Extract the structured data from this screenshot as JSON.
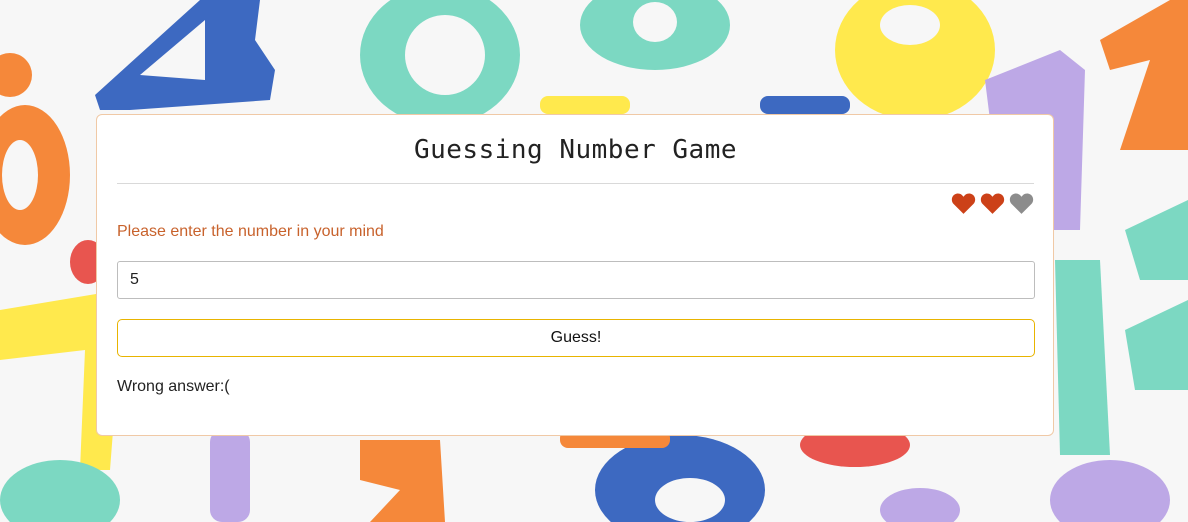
{
  "game": {
    "title": "Guessing Number Game",
    "prompt": "Please enter the number in your mind",
    "input_value": "5",
    "guess_label": "Guess!",
    "result_message": "Wrong answer:("
  },
  "lives": {
    "total": 3,
    "remaining": 2,
    "icons": [
      "heart-icon",
      "heart-icon",
      "heart-icon"
    ],
    "colors": {
      "full": "#cc4118",
      "lost": "#8c8c8c"
    }
  },
  "colors": {
    "accent": "#c8622c",
    "button_border": "#e8b400",
    "card_border": "#f0c9a6"
  }
}
